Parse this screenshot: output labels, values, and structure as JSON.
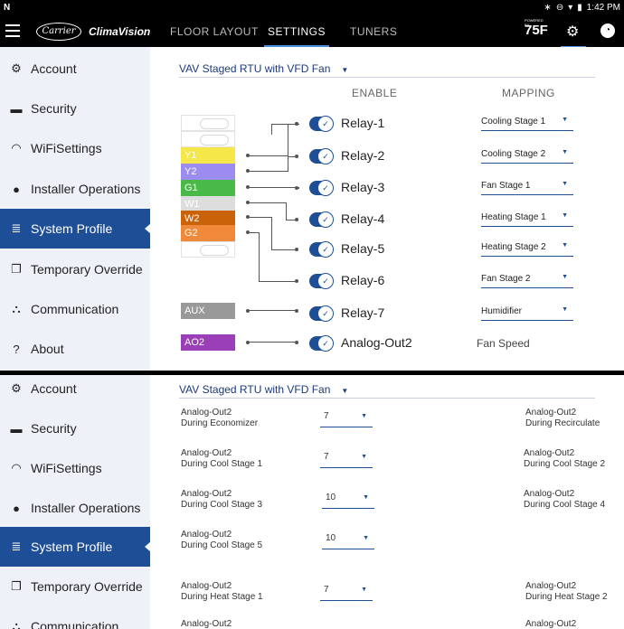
{
  "status": {
    "carrier_glyph": "N",
    "time": "1:42 PM",
    "icons": [
      "bluetooth-icon",
      "minus-circle-icon",
      "wifi-icon",
      "battery-icon"
    ]
  },
  "appbar": {
    "carrier_logo": "Carrier",
    "brand": "ClimaVision",
    "tabs": [
      "FLOOR LAYOUT",
      "SETTINGS",
      "TUNERS"
    ],
    "active_tab": "SETTINGS",
    "logo_small": "POWERED BY",
    "logo_75": "75F"
  },
  "sidebar": {
    "items": [
      {
        "label": "Account",
        "icon": "gear-icon"
      },
      {
        "label": "Security",
        "icon": "lock-icon"
      },
      {
        "label": "WiFiSettings",
        "icon": "wifi-icon"
      },
      {
        "label": "Installer Operations",
        "icon": "installer-icon"
      },
      {
        "label": "System Profile",
        "icon": "server-icon"
      },
      {
        "label": "Temporary Override",
        "icon": "copy-icon"
      },
      {
        "label": "Communication",
        "icon": "network-icon"
      },
      {
        "label": "About",
        "icon": "help-icon"
      }
    ],
    "active": "System Profile"
  },
  "profile": {
    "selected": "VAV Staged RTU with VFD Fan"
  },
  "columns": {
    "enable": "ENABLE",
    "mapping": "MAPPING"
  },
  "terminals": [
    {
      "label": "",
      "color": ""
    },
    {
      "label": "",
      "color": ""
    },
    {
      "label": "Y1",
      "color": "#f5e64a"
    },
    {
      "label": "Y2",
      "color": "#9c8cf0"
    },
    {
      "label": "G1",
      "color": "#49b948"
    },
    {
      "label": "W1",
      "color": "#dddddd"
    },
    {
      "label": "W2",
      "color": "#c96208"
    },
    {
      "label": "G2",
      "color": "#f08a3a"
    },
    {
      "label": "",
      "color": ""
    }
  ],
  "aux": {
    "label": "AUX",
    "color": "#999999"
  },
  "ao2": {
    "label": "AO2",
    "color": "#9b3fb8"
  },
  "relays": [
    {
      "label": "Relay-1",
      "mapping": "Cooling Stage 1"
    },
    {
      "label": "Relay-2",
      "mapping": "Cooling Stage 2"
    },
    {
      "label": "Relay-3",
      "mapping": "Fan Stage 1"
    },
    {
      "label": "Relay-4",
      "mapping": "Heating Stage 1"
    },
    {
      "label": "Relay-5",
      "mapping": "Heating Stage 2"
    },
    {
      "label": "Relay-6",
      "mapping": "Fan Stage 2"
    },
    {
      "label": "Relay-7",
      "mapping": "Humidifier"
    }
  ],
  "analog_out": {
    "label": "Analog-Out2",
    "mapping": "Fan Speed"
  },
  "ao_settings": {
    "left": [
      {
        "label": "Analog-Out2\nDuring Economizer",
        "value": "7"
      },
      {
        "label": "Analog-Out2\nDuring Cool Stage 1",
        "value": "7"
      },
      {
        "label": "Analog-Out2\nDuring Cool Stage 3",
        "value": "10"
      },
      {
        "label": "Analog-Out2\nDuring Cool Stage 5",
        "value": "10"
      },
      {
        "label": "Analog-Out2\nDuring Heat Stage 1",
        "value": "7"
      },
      {
        "label": "Analog-Out2",
        "value": ""
      }
    ],
    "right": [
      {
        "label": "Analog-Out2\nDuring Recirculate"
      },
      {
        "label": "Analog-Out2\nDuring Cool Stage 2"
      },
      {
        "label": "Analog-Out2\nDuring Cool Stage 4"
      },
      {
        "label": "Analog-Out2\nDuring Heat Stage 2"
      },
      {
        "label": "Analog-Out2"
      }
    ]
  }
}
